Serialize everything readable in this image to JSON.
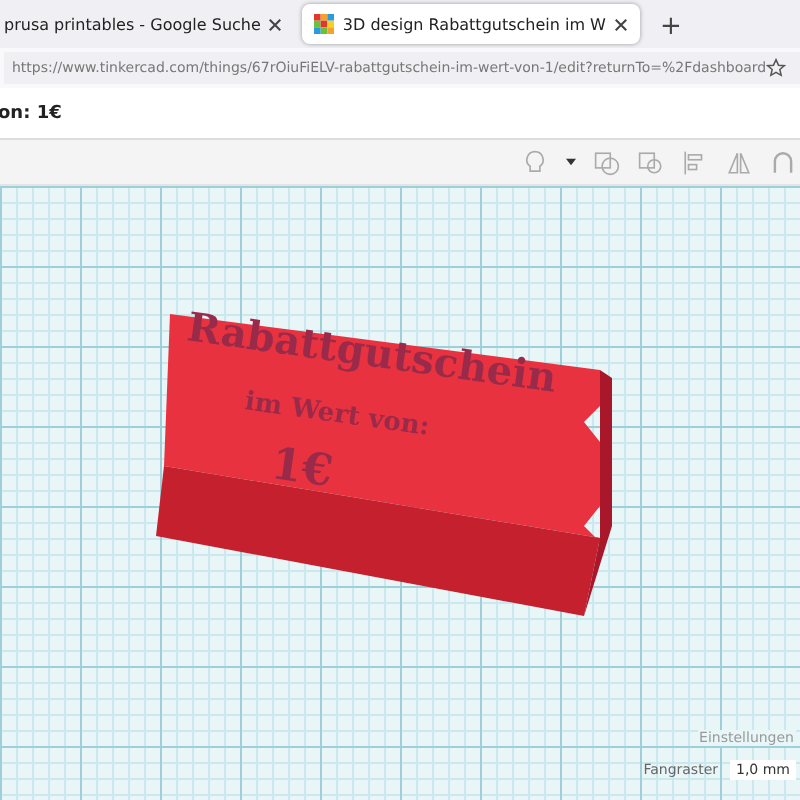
{
  "browser": {
    "tabs": [
      {
        "title": "prusa printables - Google Suche",
        "selected": false
      },
      {
        "title": "3D design Rabattgutschein im W",
        "selected": true
      }
    ],
    "new_tab": "+",
    "url": "https://www.tinkercad.com/things/67rOiuFiELV-rabattgutschein-im-wert-von-1/edit?returnTo=%2Fdashboard"
  },
  "design_title": "on: 1€",
  "model": {
    "lines": [
      "Rabattgutschein",
      "im Wert von:",
      "1€"
    ]
  },
  "footer": {
    "settings": "Einstellungen",
    "snap_label": "Fangraster",
    "snap_value": "1,0 mm"
  }
}
